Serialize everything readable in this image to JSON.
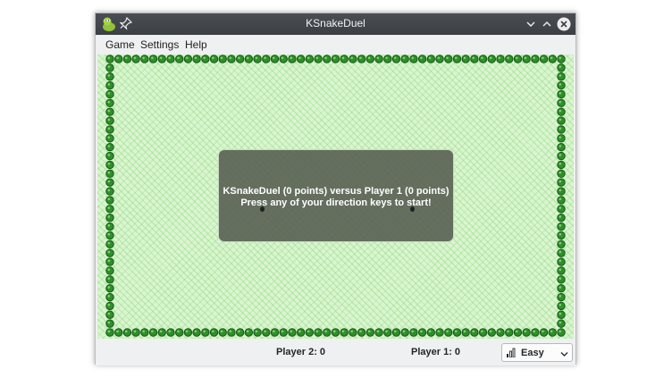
{
  "window": {
    "title": "KSnakeDuel",
    "app_icon": "snake-app-icon",
    "pin_icon": "pin-icon",
    "controls": [
      "minimize-icon",
      "maximize-icon",
      "close-icon"
    ]
  },
  "menu": {
    "items": [
      {
        "label": "Game"
      },
      {
        "label": "Settings"
      },
      {
        "label": "Help"
      }
    ]
  },
  "overlay": {
    "line1": "KSnakeDuel (0 points) versus Player 1 (0 points)",
    "line2": "Press any of your direction keys to start!"
  },
  "status": {
    "player2": "Player 2: 0",
    "player1": "Player 1: 0",
    "difficulty": "Easy",
    "difficulty_icon": "difficulty-bars-icon"
  },
  "colors": {
    "field": "#d9f5cf",
    "wall": "#2f8f2a",
    "wall_dark": "#17581a",
    "titlebar": "#3c3f43",
    "close_button": "#e8e8e8"
  }
}
